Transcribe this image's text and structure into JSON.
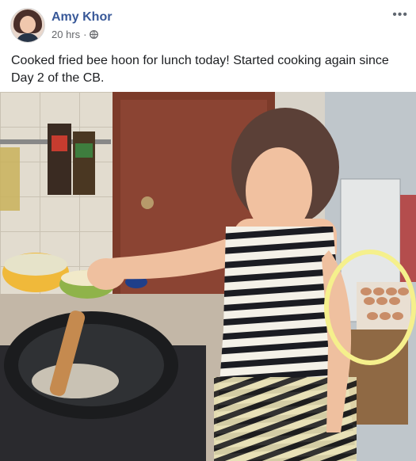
{
  "post": {
    "author": "Amy Khor",
    "timestamp": "20 hrs",
    "separator": "·",
    "privacy_icon": "globe-icon",
    "more_icon": "more-options-icon",
    "more_label": "•••",
    "text": "Cooked fried bee hoon for lunch today! Started cooking again since Day 2 of the CB."
  },
  "photo": {
    "highlight_color": "#f5f08c"
  }
}
